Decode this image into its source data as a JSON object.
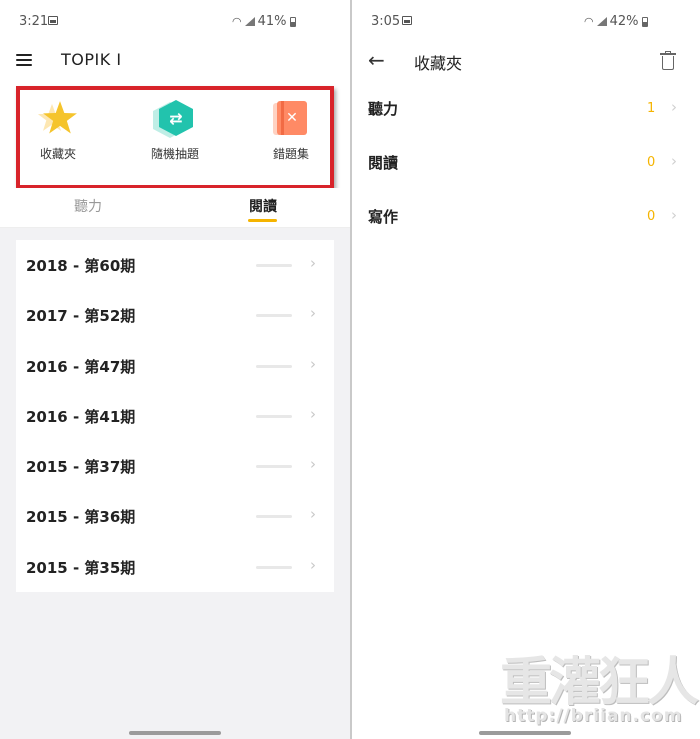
{
  "left": {
    "status_bar": {
      "time": "3:21",
      "battery": "41%"
    },
    "header": {
      "title": "TOPIK Ⅰ"
    },
    "shortcuts": [
      {
        "label": "收藏夾",
        "icon": "star-icon",
        "color": "#f5c42c"
      },
      {
        "label": "隨機抽題",
        "icon": "shuffle-icon",
        "color": "#22c3ad"
      },
      {
        "label": "錯題集",
        "icon": "wrong-answers-book-icon",
        "color": "#ff8a65"
      }
    ],
    "tabs": [
      {
        "label": "聽力",
        "active": false
      },
      {
        "label": "閱讀",
        "active": true
      }
    ],
    "exams": [
      {
        "label": "2018 - 第60期"
      },
      {
        "label": "2017 - 第52期"
      },
      {
        "label": "2016 - 第47期"
      },
      {
        "label": "2016 - 第41期"
      },
      {
        "label": "2015 - 第37期"
      },
      {
        "label": "2015 - 第36期"
      },
      {
        "label": "2015 - 第35期"
      }
    ]
  },
  "right": {
    "status_bar": {
      "time": "3:05",
      "battery": "42%"
    },
    "header": {
      "title": "收藏夾"
    },
    "favorites": [
      {
        "label": "聽力",
        "count": "1"
      },
      {
        "label": "閱讀",
        "count": "0"
      },
      {
        "label": "寫作",
        "count": "0"
      }
    ],
    "watermark": {
      "brand": "重灌狂人",
      "url": "http://briian.com"
    }
  },
  "colors": {
    "accent": "#f5b400",
    "highlight_frame": "#d8232a",
    "page_background": "#f2f2f4"
  }
}
